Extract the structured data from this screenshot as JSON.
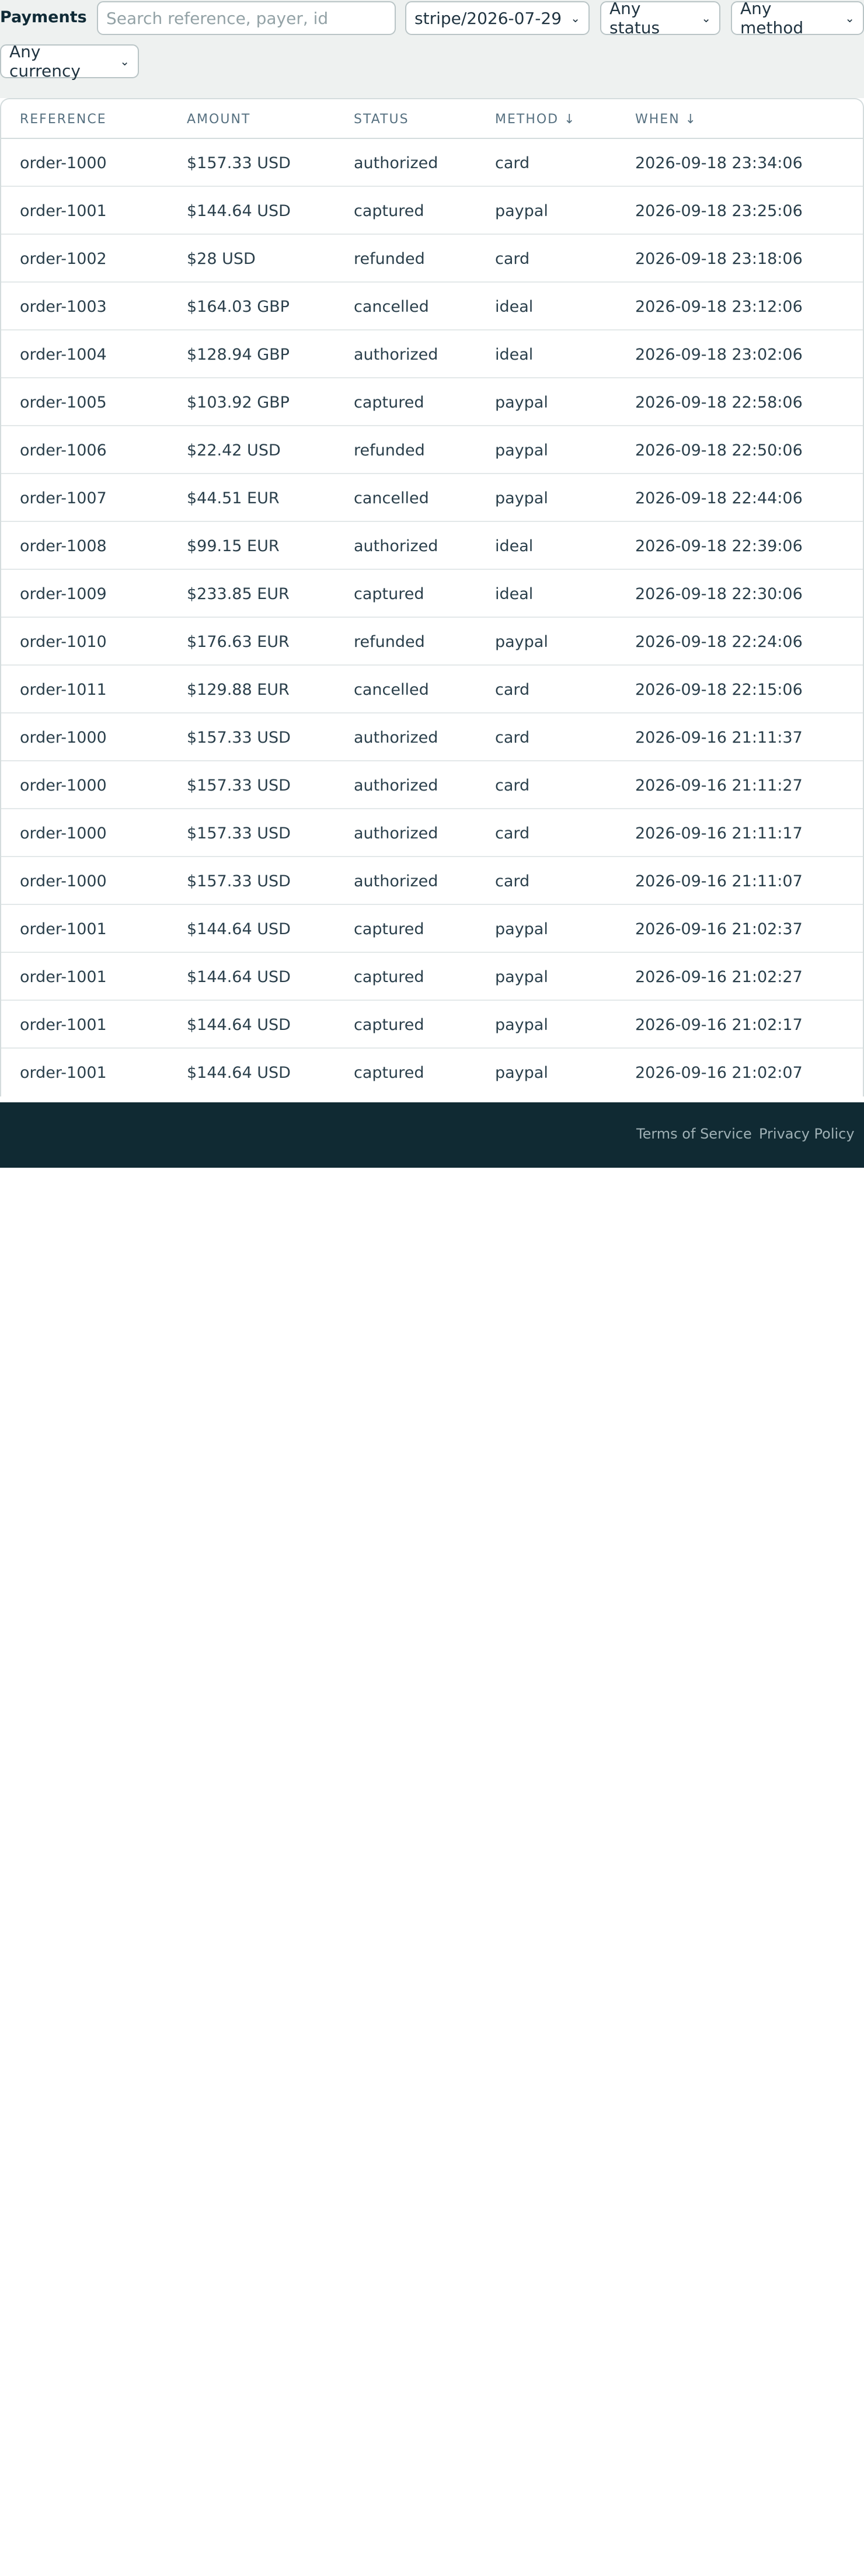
{
  "header": {
    "title": "Payments"
  },
  "filters": {
    "search_placeholder": "Search reference, payer, id",
    "source": "stripe/2026-07-29",
    "status": "Any status",
    "method": "Any method",
    "currency": "Any currency"
  },
  "table": {
    "columns": [
      "Reference",
      "Amount",
      "Status",
      "Method ↓",
      "When ↓"
    ],
    "rows": [
      [
        "order-1000",
        "$157.33 USD",
        "authorized",
        "card",
        "2026-09-18 23:34:06"
      ],
      [
        "order-1001",
        "$144.64 USD",
        "captured",
        "paypal",
        "2026-09-18 23:25:06"
      ],
      [
        "order-1002",
        "$28 USD",
        "refunded",
        "card",
        "2026-09-18 23:18:06"
      ],
      [
        "order-1003",
        "$164.03 GBP",
        "cancelled",
        "ideal",
        "2026-09-18 23:12:06"
      ],
      [
        "order-1004",
        "$128.94 GBP",
        "authorized",
        "ideal",
        "2026-09-18 23:02:06"
      ],
      [
        "order-1005",
        "$103.92 GBP",
        "captured",
        "paypal",
        "2026-09-18 22:58:06"
      ],
      [
        "order-1006",
        "$22.42 USD",
        "refunded",
        "paypal",
        "2026-09-18 22:50:06"
      ],
      [
        "order-1007",
        "$44.51 EUR",
        "cancelled",
        "paypal",
        "2026-09-18 22:44:06"
      ],
      [
        "order-1008",
        "$99.15 EUR",
        "authorized",
        "ideal",
        "2026-09-18 22:39:06"
      ],
      [
        "order-1009",
        "$233.85 EUR",
        "captured",
        "ideal",
        "2026-09-18 22:30:06"
      ],
      [
        "order-1010",
        "$176.63 EUR",
        "refunded",
        "paypal",
        "2026-09-18 22:24:06"
      ],
      [
        "order-1011",
        "$129.88 EUR",
        "cancelled",
        "card",
        "2026-09-18 22:15:06"
      ],
      [
        "order-1000",
        "$157.33 USD",
        "authorized",
        "card",
        "2026-09-16 21:11:37"
      ],
      [
        "order-1000",
        "$157.33 USD",
        "authorized",
        "card",
        "2026-09-16 21:11:27"
      ],
      [
        "order-1000",
        "$157.33 USD",
        "authorized",
        "card",
        "2026-09-16 21:11:17"
      ],
      [
        "order-1000",
        "$157.33 USD",
        "authorized",
        "card",
        "2026-09-16 21:11:07"
      ],
      [
        "order-1001",
        "$144.64 USD",
        "captured",
        "paypal",
        "2026-09-16 21:02:37"
      ],
      [
        "order-1001",
        "$144.64 USD",
        "captured",
        "paypal",
        "2026-09-16 21:02:27"
      ],
      [
        "order-1001",
        "$144.64 USD",
        "captured",
        "paypal",
        "2026-09-16 21:02:17"
      ],
      [
        "order-1001",
        "$144.64 USD",
        "captured",
        "paypal",
        "2026-09-16 21:02:07"
      ]
    ]
  },
  "footer": {
    "terms": "Terms of Service",
    "privacy": "Privacy Policy"
  },
  "icons": {
    "select_chevron": "chevron-down-icon"
  },
  "colors": {
    "background": "#eef1f0",
    "footer": "#102a33",
    "text": "#1f3340"
  }
}
